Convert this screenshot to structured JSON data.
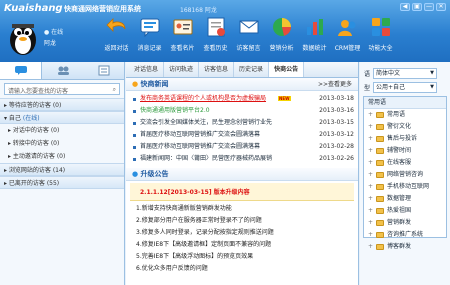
{
  "header": {
    "logo": "Kuaishang",
    "app_title": "快商通网络营销应用系统",
    "user_id": "168168",
    "user_id_name": "阿龙",
    "status": "在线",
    "username": "阿龙",
    "window_buttons": [
      "◀",
      "▣",
      "—",
      "✕"
    ]
  },
  "toolbar": [
    {
      "label": "返回对话",
      "icon": "back-arrow-icon"
    },
    {
      "label": "消息记录",
      "icon": "speech-bubble-icon"
    },
    {
      "label": "查看名片",
      "icon": "business-card-icon"
    },
    {
      "label": "查看历史",
      "icon": "history-icon"
    },
    {
      "label": "访客留言",
      "icon": "message-icon"
    },
    {
      "label": "营销分析",
      "icon": "analysis-icon"
    },
    {
      "label": "数据统计",
      "icon": "statistics-icon"
    },
    {
      "label": "CRM管理",
      "icon": "crm-icon"
    },
    {
      "label": "功能大全",
      "icon": "functions-icon"
    }
  ],
  "left": {
    "search_placeholder": "请输入您要查找的访客",
    "groups": [
      {
        "label": "等待应答的访客 (0)"
      },
      {
        "label": "自己",
        "status": "(在线)"
      },
      {
        "label": "浏览网站的访客 (14)"
      },
      {
        "label": "已离开的访客 (55)"
      }
    ],
    "sub_items": [
      "对话中的访客 (0)",
      "转接中的访客 (0)",
      "主动邀请的访客 (0)"
    ]
  },
  "center": {
    "tabs": [
      "对话信息",
      "访问轨迹",
      "访客信息",
      "历史记录",
      "快商公告"
    ],
    "news_header": "快商新闻",
    "more": ">>查看更多",
    "news": [
      {
        "title": "发布商务英语课程的个人或机构是否为虚报骗局",
        "date": "2013-03-18",
        "style": "red",
        "is_new": true
      },
      {
        "title": "快商通通用版营销平台2.0",
        "date": "2013-03-16",
        "style": "green",
        "is_new": false
      },
      {
        "title": "交流会引发全国媒体关注，民生理念创营销行业先",
        "date": "2013-03-15",
        "style": "normal",
        "is_new": false
      },
      {
        "title": "首届医疗移动互联网营销推广交流会圆满落幕",
        "date": "2013-03-12",
        "style": "normal",
        "is_new": false
      },
      {
        "title": "首届医疗移动互联网营销推广交流会圆满落幕",
        "date": "2013-02-28",
        "style": "normal",
        "is_new": false
      },
      {
        "title": "福建新闻网：中国〈莆田〉民营医疗器械药品展销",
        "date": "2013-02-26",
        "style": "normal",
        "is_new": false
      }
    ],
    "new_badge": "NEW",
    "upgrade_header": "升级公告",
    "upgrade_title": "2.1.1.12[2013-03-15] 版本升级内容",
    "upgrade_items": [
      "1.新增支持快商通新版营销群发功能",
      "2.修复部分用户在服务器正常时登录不了的问题",
      "3.修复多人同时登录，记录分配按指定规则推送问题",
      "4.修复IE8下【高级邀请框】定制页面不兼容的问题",
      "5.完善IE8下【高级浮动图标】的预览页效果",
      "6.优化众多用户反馈的问题"
    ]
  },
  "right": {
    "lang_label": "语",
    "lang_value": "简体中文",
    "type_label": "型",
    "type_value": "公用+自己",
    "common_label": "常用语",
    "folders": [
      "常用语",
      "警衍文化",
      "售后与投诉",
      "辅警时间",
      "在线客服",
      "网络营销咨询",
      "手机移动互联网",
      "数据管理",
      "热爱祖国",
      "营销群发",
      "咨询推广系统",
      "博客群发"
    ]
  }
}
